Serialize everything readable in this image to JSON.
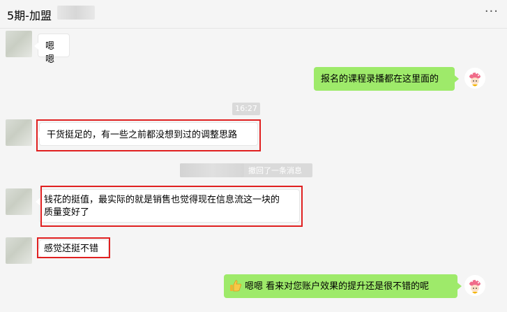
{
  "header": {
    "title": "5期-加盟",
    "more_label": "···"
  },
  "messages": {
    "m1": "嗯嗯",
    "m2": "报名的课程录播都在这里面的",
    "time": "16:27",
    "m3": "干货挺足的，有一些之前都没想到过的调整思路",
    "recall": "撤回了一条消息",
    "m4_line1": "钱花的挺值，最实际的就是销售也觉得现在信息流这一块的",
    "m4_line2": "质量变好了",
    "m5": "感觉还挺不错",
    "m6": "嗯嗯 看来对您账户效果的提升还是很不错的呢"
  },
  "icons": {
    "more": "ellipsis-icon",
    "thumbs_up": "thumbs-up-icon",
    "right_avatar": "strawberry-girl-avatar"
  },
  "colors": {
    "right_bubble": "#9eea6a",
    "highlight_box": "#e02020",
    "background": "#f5f5f5"
  }
}
